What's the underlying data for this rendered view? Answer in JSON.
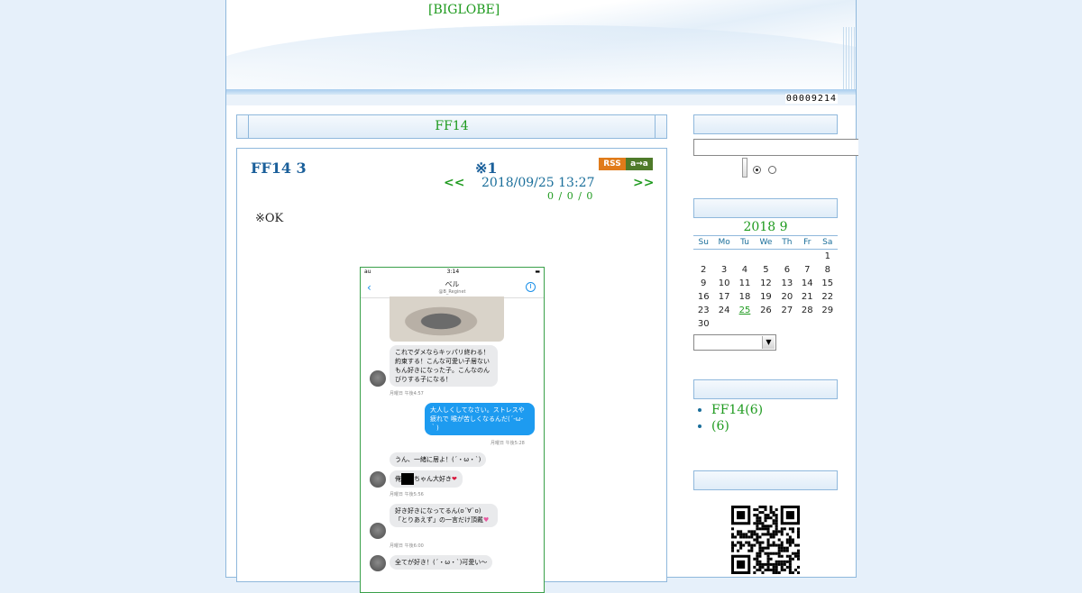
{
  "header": {
    "brand": "[BIGLOBE]",
    "counter": "00009214"
  },
  "category_bar": {
    "title": "FF14"
  },
  "entry": {
    "title": "FF14 3",
    "mark": "※1",
    "rss_label": "RSS",
    "aa_label": "a→a",
    "prev_label": "<<",
    "next_label": ">>",
    "date": "2018/09/25 13:27",
    "stats": "0 / 0 / 0",
    "body": "※OK"
  },
  "screenshot": {
    "carrier": "au",
    "time": "3:14",
    "contact_name": "ベル",
    "contact_handle": "@B_Reginet",
    "messages": [
      {
        "from": "them",
        "text": "これでダメならキッパリ終わる！約束する！こんな可愛い子居ないもん好きになった子。こんなのんびりする子になる！",
        "time": "月曜日 午後4:57"
      },
      {
        "from": "me",
        "text": "大人しくしてなさい。ストレスや疲れで 喉が苦しくなるんだ(´-ω-｀)",
        "time": "月曜日 午後5:28"
      },
      {
        "from": "them",
        "text": "うん、一緒に居よ！(´・ω・`)",
        "time": ""
      },
      {
        "from": "them",
        "text_before": "俺",
        "text_after": "ちゃん大好き",
        "time": "月曜日 午後5:56"
      },
      {
        "from": "them",
        "text": "好き好きになってるん(o´∀`o)「とりあえず」の一言だけ頂戴",
        "time": "月曜日 午後6:00"
      },
      {
        "from": "them",
        "text": "全てが好き！(´・ω・`)可愛い〜",
        "time": ""
      }
    ]
  },
  "sidebar": {
    "search_placeholder": "",
    "calendar": {
      "title": "2018 9",
      "weekdays": [
        "Su",
        "Mo",
        "Tu",
        "We",
        "Th",
        "Fr",
        "Sa"
      ],
      "weeks": [
        [
          "",
          "",
          "",
          "",
          "",
          "",
          "1"
        ],
        [
          "2",
          "3",
          "4",
          "5",
          "6",
          "7",
          "8"
        ],
        [
          "9",
          "10",
          "11",
          "12",
          "13",
          "14",
          "15"
        ],
        [
          "16",
          "17",
          "18",
          "19",
          "20",
          "21",
          "22"
        ],
        [
          "23",
          "24",
          "25",
          "26",
          "27",
          "28",
          "29"
        ],
        [
          "30",
          "",
          "",
          "",
          "",
          "",
          ""
        ]
      ],
      "linked_day": "25"
    },
    "categories": [
      {
        "label": "FF14(6)"
      },
      {
        "label": "(6)"
      }
    ]
  },
  "colors": {
    "link_green": "#1e9a1e",
    "title_blue": "#1a5f9a",
    "border_blue": "#8fb8dc",
    "page_bg": "#e6f0fa"
  }
}
